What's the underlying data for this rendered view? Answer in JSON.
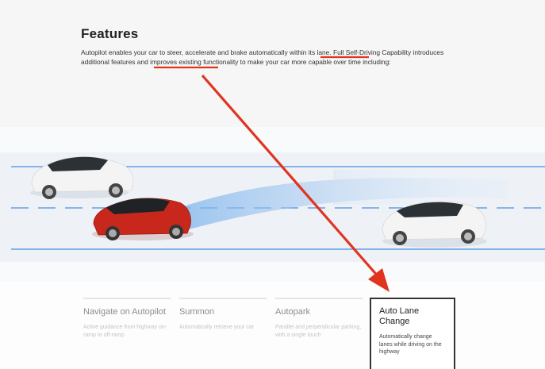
{
  "section": {
    "title": "Features",
    "intro": {
      "part1": "Autopilot enables your car to steer, accelerate and brake automatically ",
      "highlight1": "within its lane.",
      "part2": " Full Self-Driving Capability introduces ",
      "highlight2": "additional features",
      "part3": " and improves existing functionality to make your car more capable over time including:"
    }
  },
  "features": [
    {
      "title": "Navigate on Autopilot",
      "description": "Active guidance from highway on-ramp to off-ramp"
    },
    {
      "title": "Summon",
      "description": "Automatically retrieve your car"
    },
    {
      "title": "Autopark",
      "description": "Parallel and perpendicular parking, with a single touch"
    },
    {
      "title": "Auto Lane Change",
      "description": "Automatically change lanes while driving on the highway"
    }
  ],
  "colors": {
    "annotation": "#e0341f",
    "lane_line": "#4a8fe0",
    "red_car": "#c8281c",
    "white_car": "#f4f4f4"
  }
}
